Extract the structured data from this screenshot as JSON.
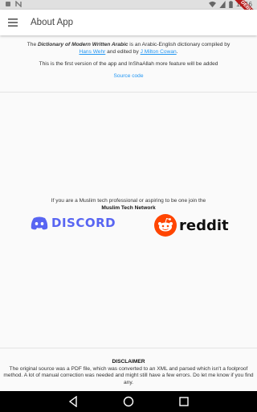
{
  "status_bar": {
    "time": "12:16",
    "debug_label": "DEBUG"
  },
  "app_bar": {
    "title": "About App"
  },
  "intro": {
    "prefix": "The ",
    "dictionary_name": "Dictionary of Modern Written Arabic",
    "middle": " is an Arabic-English dictionary compiled by ",
    "author_link": "Hans Wehr",
    "editor_text": " and edited by ",
    "editor_link": "J Milton Cowan",
    "suffix": "."
  },
  "first_version": "This is the first version of the app and InShaAllah more feature will be added",
  "source_code_link": "Source code",
  "community": {
    "invite": "If you are a Muslim tech professional or aspiring to be one join the",
    "network_name": "Muslim Tech Network",
    "discord_label": "DISCORD",
    "reddit_label": "reddit"
  },
  "disclaimer": {
    "title": "DISCLAIMER",
    "body": "The original source was a PDF file, which was converted to an XML and parsed which isn't a foolproof method. A lot of manual correction was needed and might still have a few errors. Do let me know if you find any."
  },
  "colors": {
    "link": "#2196f3",
    "discord": "#5865f2",
    "reddit": "#ff4500",
    "debug_banner": "#b71c1c"
  },
  "icons": [
    "menu-icon",
    "back-icon",
    "home-icon",
    "recents-icon",
    "wifi-icon",
    "signal-icon",
    "battery-icon"
  ]
}
